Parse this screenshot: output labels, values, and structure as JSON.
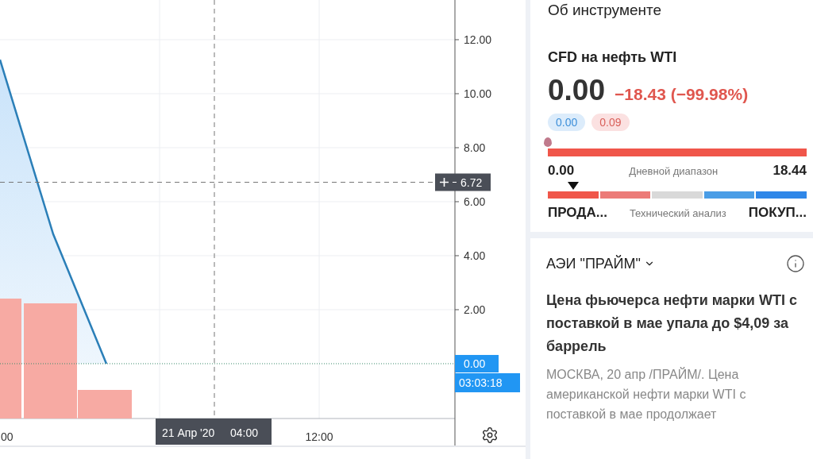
{
  "chart": {
    "chart_data": {
      "type": "area",
      "grid": true,
      "categories": [
        "00",
        null,
        null,
        null,
        null,
        null,
        "12:00",
        null,
        null
      ],
      "ylim": [
        -2.03,
        13.47
      ],
      "yticks": [
        {
          "value": 2,
          "label": "2.00"
        },
        {
          "value": 4,
          "label": "4.00"
        },
        {
          "value": 6,
          "label": "6.00"
        },
        {
          "value": 8,
          "label": "8.00"
        },
        {
          "value": 10,
          "label": "10.00"
        },
        {
          "value": 12,
          "label": "12.00"
        }
      ],
      "series": [
        {
          "color": "#2b7fb8",
          "values": [
            11.26,
            4.8,
            0,
            null,
            null,
            null,
            null,
            null,
            null
          ]
        }
      ]
    },
    "crosshair": {
      "price": "6.72",
      "date": "21 Апр '20",
      "time": "04:00"
    },
    "last_price": {
      "price": "0.00",
      "countdown": "03:03:18"
    }
  },
  "about": {
    "title": "Об инструменте",
    "symbol": "CFD на нефть WTI",
    "price": "0.00",
    "change": "−18.43 (−99.98%)",
    "bid": "0.00",
    "ask": "0.09",
    "day_range": {
      "low": "0.00",
      "label": "Дневной диапазон",
      "high": "18.44",
      "level": 0
    },
    "technicals": {
      "segments": [
        {
          "color": "#f0564a",
          "selected": true
        },
        {
          "color": "#ec7b78",
          "selected": false
        },
        {
          "color": "#d9d9d9",
          "selected": false
        },
        {
          "color": "#4a9de6",
          "selected": false
        },
        {
          "color": "#2f87e8",
          "selected": false
        }
      ],
      "sell": "ПРОДА...",
      "label": "Технический анализ",
      "buy": "ПОКУП..."
    }
  },
  "news": {
    "source": "АЭИ \"ПРАЙМ\"",
    "headline": "Цена фьючерса нефти марки WTI с поставкой в мае упала до $4,09 за баррель",
    "body": "МОСКВА, 20 апр /ПРАЙМ/. Цена американской нефти марки WTI с поставкой в мае продолжает"
  }
}
